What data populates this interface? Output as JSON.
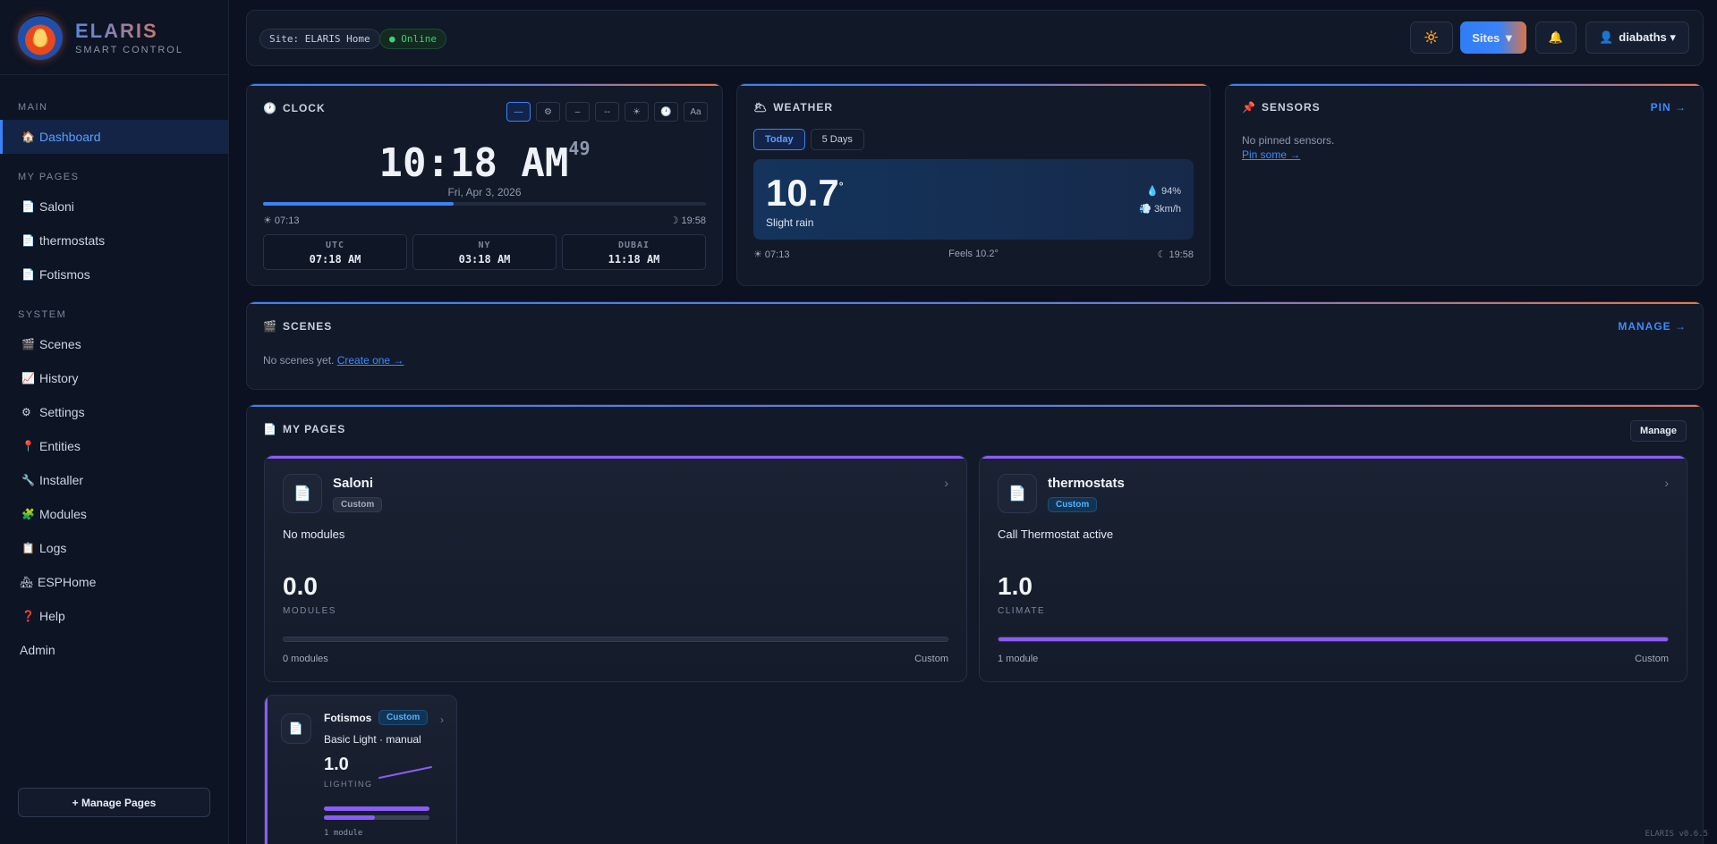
{
  "brand": {
    "name": "ELARIS",
    "subtitle": "SMART CONTROL"
  },
  "sidebar": {
    "section_main": "MAIN",
    "dashboard": {
      "icon": "home-icon",
      "label": "Dashboard"
    },
    "section_pages": "MY PAGES",
    "pages": [
      {
        "icon": "page-icon",
        "label": "Saloni"
      },
      {
        "icon": "page-icon",
        "label": "thermostats"
      },
      {
        "icon": "page-icon",
        "label": "Fotismos"
      }
    ],
    "section_system": "SYSTEM",
    "system": [
      {
        "icon": "clapper-icon",
        "label": "Scenes"
      },
      {
        "icon": "chart-icon",
        "label": "History"
      },
      {
        "icon": "gear-icon",
        "label": "Settings"
      },
      {
        "icon": "pin-icon",
        "label": "Entities"
      },
      {
        "icon": "wrench-icon",
        "label": "Installer"
      },
      {
        "icon": "puzzle-icon",
        "label": "Modules"
      },
      {
        "icon": "clipboard-icon",
        "label": "Logs"
      },
      {
        "icon": "house-icon",
        "label": "ESPHome"
      },
      {
        "icon": "help-icon",
        "label": "Help"
      }
    ],
    "admin": "Admin",
    "manage_pages": "+ Manage Pages"
  },
  "topbar": {
    "site": "Site: ELARIS Home",
    "status": "● Online",
    "sites_label": "Sites ▼",
    "user": "diabaths ▾"
  },
  "clock": {
    "title": "CLOCK",
    "time": "10:18 AM",
    "seconds": "49",
    "date": "Fri, Apr 3, 2026",
    "day_progress": 0.43,
    "sunrise": "☀ 07:13",
    "sunset": "☽ 19:58",
    "zones": [
      {
        "name": "UTC",
        "time": "07:18 AM"
      },
      {
        "name": "NY",
        "time": "03:18 AM"
      },
      {
        "name": "DUBAI",
        "time": "11:18 AM"
      }
    ]
  },
  "weather": {
    "title": "WEATHER",
    "tab_today": "Today",
    "tab_5days": "5 Days",
    "temp": "10.7",
    "deg": "°",
    "condition": "Slight rain",
    "humidity": "💧 94%",
    "wind": "💨 3km/h",
    "sunrise": "☀ 07:13",
    "feels": "Feels 10.2°",
    "sunset": "☾ 19:58"
  },
  "sensors": {
    "title": "SENSORS",
    "action": "PIN →",
    "empty": "No pinned sensors.",
    "link": "Pin some →"
  },
  "scenes": {
    "title": "SCENES",
    "action": "MANAGE →",
    "empty": "No scenes yet.",
    "link": "Create one →"
  },
  "mypages": {
    "title": "MY PAGES",
    "manage": "Manage",
    "cards": [
      {
        "name": "Saloni",
        "badge": "Custom",
        "desc": "No modules",
        "value": "0.0",
        "unit": "MODULES",
        "progress": 0.0,
        "count": "0 modules",
        "type": "Custom"
      },
      {
        "name": "thermostats",
        "badge": "Custom",
        "desc": "Call Thermostat active",
        "value": "1.0",
        "unit": "CLIMATE",
        "progress": 1.0,
        "count": "1 module",
        "type": "Custom"
      },
      {
        "name": "Fotismos",
        "badge": "Custom",
        "desc": "Basic Light · manual",
        "value": "1.0",
        "unit": "LIGHTING",
        "progress": 1.0,
        "progress2": 0.48,
        "count": "1 module"
      }
    ]
  },
  "version": "ELARIS v0.6.5",
  "colors": {
    "accent": "#3b82f6",
    "purple": "#8b5cf6",
    "orange": "#e8764a",
    "online": "#3ecf7a"
  }
}
